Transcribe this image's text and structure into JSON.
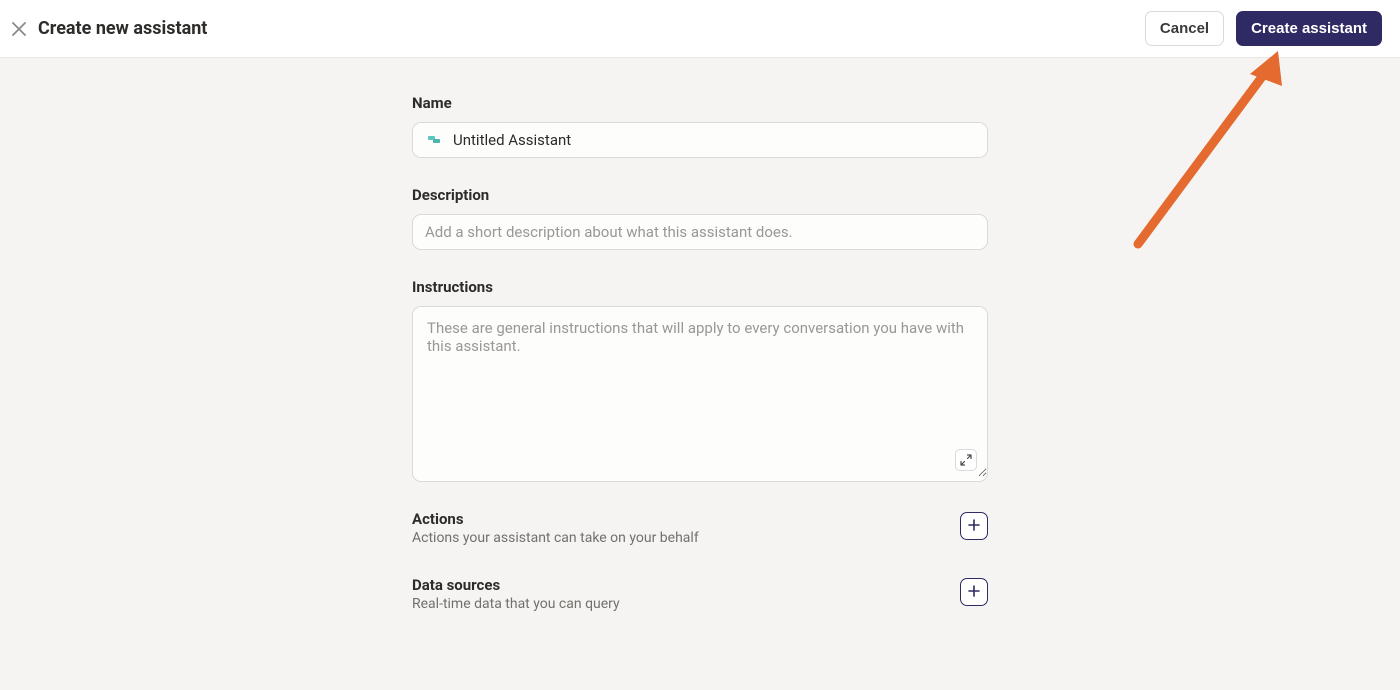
{
  "header": {
    "title": "Create new assistant",
    "cancel_label": "Cancel",
    "create_label": "Create assistant"
  },
  "form": {
    "name": {
      "label": "Name",
      "value": "Untitled Assistant"
    },
    "description": {
      "label": "Description",
      "placeholder": "Add a short description about what this assistant does."
    },
    "instructions": {
      "label": "Instructions",
      "placeholder": "These are general instructions that will apply to every conversation you have with this assistant."
    },
    "actions": {
      "title": "Actions",
      "subtitle": "Actions your assistant can take on your behalf"
    },
    "data_sources": {
      "title": "Data sources",
      "subtitle": "Real-time data that you can query"
    }
  },
  "colors": {
    "primary": "#2f2a63",
    "arrow": "#e46a2f"
  }
}
